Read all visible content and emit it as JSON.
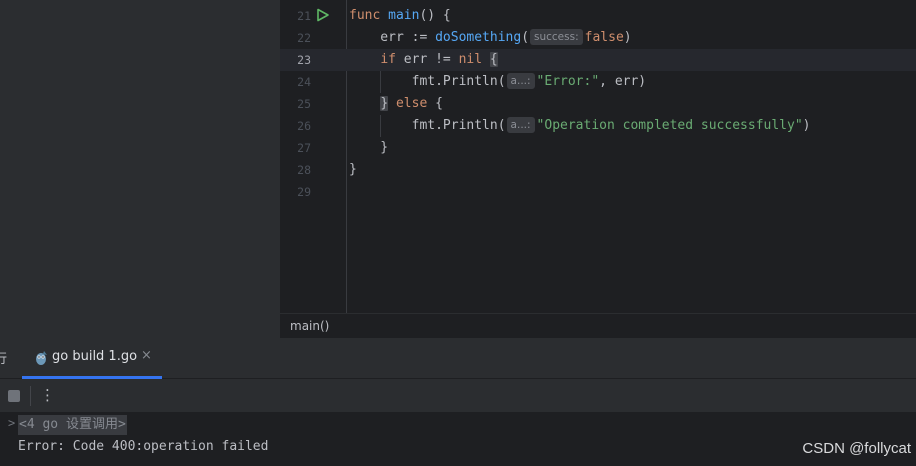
{
  "editor": {
    "current_line": 23,
    "lines": [
      {
        "number": "21",
        "tokens": [
          "func",
          " ",
          "main",
          "() {"
        ]
      },
      {
        "number": "22",
        "tokens": [
          "    err := ",
          "doSomething",
          "(",
          "success:",
          "false",
          ")"
        ]
      },
      {
        "number": "23",
        "tokens": [
          "    ",
          "if",
          " err != ",
          "nil",
          " ",
          "{"
        ]
      },
      {
        "number": "24",
        "tokens": [
          "        fmt.Println(",
          "a...:",
          "\"Error:\"",
          ", err)"
        ]
      },
      {
        "number": "25",
        "tokens": [
          "    ",
          "}",
          " ",
          "else",
          " {"
        ]
      },
      {
        "number": "26",
        "tokens": [
          "        fmt.Println(",
          "a...:",
          "\"Operation completed successfully\"",
          ")"
        ]
      },
      {
        "number": "27",
        "tokens": [
          "    }"
        ]
      },
      {
        "number": "28",
        "tokens": [
          "}"
        ]
      },
      {
        "number": "29",
        "tokens": []
      }
    ],
    "breadcrumb": "main()"
  },
  "tool_window": {
    "partial_tab": "行",
    "run_tab": {
      "label": "go build 1.go",
      "icon": "go-gopher-icon",
      "close": "×"
    },
    "toolbar": {
      "stop_icon": "stop-icon",
      "more": "⋮"
    }
  },
  "console": {
    "fold_marker": ">",
    "folded_line": "<4 go 设置调用>",
    "output": "Error: Code 400:operation failed"
  },
  "watermark": "CSDN @follycat",
  "colors": {
    "keyword": "#cf8e6d",
    "function": "#56a8f5",
    "string": "#6aab73",
    "accent": "#3574f0",
    "run_icon": "#5fb865"
  }
}
